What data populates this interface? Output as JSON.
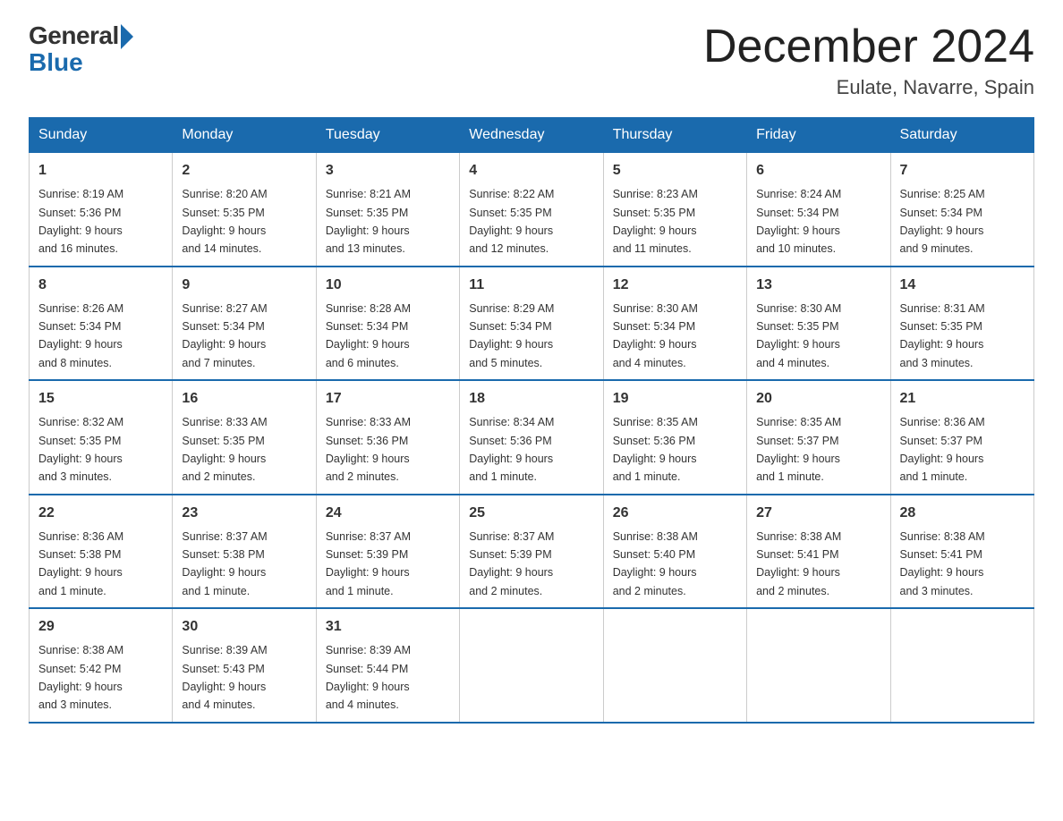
{
  "header": {
    "logo_general": "General",
    "logo_blue": "Blue",
    "month_title": "December 2024",
    "location": "Eulate, Navarre, Spain"
  },
  "days_of_week": [
    "Sunday",
    "Monday",
    "Tuesday",
    "Wednesday",
    "Thursday",
    "Friday",
    "Saturday"
  ],
  "weeks": [
    [
      {
        "day": "1",
        "sunrise": "8:19 AM",
        "sunset": "5:36 PM",
        "daylight": "9 hours and 16 minutes."
      },
      {
        "day": "2",
        "sunrise": "8:20 AM",
        "sunset": "5:35 PM",
        "daylight": "9 hours and 14 minutes."
      },
      {
        "day": "3",
        "sunrise": "8:21 AM",
        "sunset": "5:35 PM",
        "daylight": "9 hours and 13 minutes."
      },
      {
        "day": "4",
        "sunrise": "8:22 AM",
        "sunset": "5:35 PM",
        "daylight": "9 hours and 12 minutes."
      },
      {
        "day": "5",
        "sunrise": "8:23 AM",
        "sunset": "5:35 PM",
        "daylight": "9 hours and 11 minutes."
      },
      {
        "day": "6",
        "sunrise": "8:24 AM",
        "sunset": "5:34 PM",
        "daylight": "9 hours and 10 minutes."
      },
      {
        "day": "7",
        "sunrise": "8:25 AM",
        "sunset": "5:34 PM",
        "daylight": "9 hours and 9 minutes."
      }
    ],
    [
      {
        "day": "8",
        "sunrise": "8:26 AM",
        "sunset": "5:34 PM",
        "daylight": "9 hours and 8 minutes."
      },
      {
        "day": "9",
        "sunrise": "8:27 AM",
        "sunset": "5:34 PM",
        "daylight": "9 hours and 7 minutes."
      },
      {
        "day": "10",
        "sunrise": "8:28 AM",
        "sunset": "5:34 PM",
        "daylight": "9 hours and 6 minutes."
      },
      {
        "day": "11",
        "sunrise": "8:29 AM",
        "sunset": "5:34 PM",
        "daylight": "9 hours and 5 minutes."
      },
      {
        "day": "12",
        "sunrise": "8:30 AM",
        "sunset": "5:34 PM",
        "daylight": "9 hours and 4 minutes."
      },
      {
        "day": "13",
        "sunrise": "8:30 AM",
        "sunset": "5:35 PM",
        "daylight": "9 hours and 4 minutes."
      },
      {
        "day": "14",
        "sunrise": "8:31 AM",
        "sunset": "5:35 PM",
        "daylight": "9 hours and 3 minutes."
      }
    ],
    [
      {
        "day": "15",
        "sunrise": "8:32 AM",
        "sunset": "5:35 PM",
        "daylight": "9 hours and 3 minutes."
      },
      {
        "day": "16",
        "sunrise": "8:33 AM",
        "sunset": "5:35 PM",
        "daylight": "9 hours and 2 minutes."
      },
      {
        "day": "17",
        "sunrise": "8:33 AM",
        "sunset": "5:36 PM",
        "daylight": "9 hours and 2 minutes."
      },
      {
        "day": "18",
        "sunrise": "8:34 AM",
        "sunset": "5:36 PM",
        "daylight": "9 hours and 1 minute."
      },
      {
        "day": "19",
        "sunrise": "8:35 AM",
        "sunset": "5:36 PM",
        "daylight": "9 hours and 1 minute."
      },
      {
        "day": "20",
        "sunrise": "8:35 AM",
        "sunset": "5:37 PM",
        "daylight": "9 hours and 1 minute."
      },
      {
        "day": "21",
        "sunrise": "8:36 AM",
        "sunset": "5:37 PM",
        "daylight": "9 hours and 1 minute."
      }
    ],
    [
      {
        "day": "22",
        "sunrise": "8:36 AM",
        "sunset": "5:38 PM",
        "daylight": "9 hours and 1 minute."
      },
      {
        "day": "23",
        "sunrise": "8:37 AM",
        "sunset": "5:38 PM",
        "daylight": "9 hours and 1 minute."
      },
      {
        "day": "24",
        "sunrise": "8:37 AM",
        "sunset": "5:39 PM",
        "daylight": "9 hours and 1 minute."
      },
      {
        "day": "25",
        "sunrise": "8:37 AM",
        "sunset": "5:39 PM",
        "daylight": "9 hours and 2 minutes."
      },
      {
        "day": "26",
        "sunrise": "8:38 AM",
        "sunset": "5:40 PM",
        "daylight": "9 hours and 2 minutes."
      },
      {
        "day": "27",
        "sunrise": "8:38 AM",
        "sunset": "5:41 PM",
        "daylight": "9 hours and 2 minutes."
      },
      {
        "day": "28",
        "sunrise": "8:38 AM",
        "sunset": "5:41 PM",
        "daylight": "9 hours and 3 minutes."
      }
    ],
    [
      {
        "day": "29",
        "sunrise": "8:38 AM",
        "sunset": "5:42 PM",
        "daylight": "9 hours and 3 minutes."
      },
      {
        "day": "30",
        "sunrise": "8:39 AM",
        "sunset": "5:43 PM",
        "daylight": "9 hours and 4 minutes."
      },
      {
        "day": "31",
        "sunrise": "8:39 AM",
        "sunset": "5:44 PM",
        "daylight": "9 hours and 4 minutes."
      },
      null,
      null,
      null,
      null
    ]
  ],
  "labels": {
    "sunrise": "Sunrise:",
    "sunset": "Sunset:",
    "daylight": "Daylight:"
  }
}
